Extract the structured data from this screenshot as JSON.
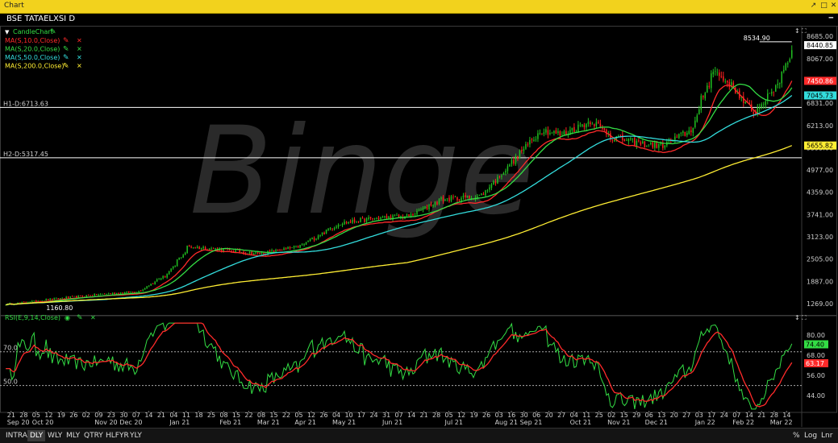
{
  "window": {
    "title": "Chart"
  },
  "symbol": {
    "label": "BSE TATAELXSI D"
  },
  "legend": {
    "chart_label": "CandleChart",
    "ma": [
      {
        "label": "MA(S,10.0,Close)",
        "color": "#ff2a2a",
        "icon": "pencil-icon"
      },
      {
        "label": "MA(S,20.0,Close)",
        "color": "#33dd44",
        "icon": "pencil-icon"
      },
      {
        "label": "MA(S,50.0,Close)",
        "color": "#33dddd",
        "icon": "pencil-icon"
      },
      {
        "label": "MA(S,200.0,Close)",
        "color": "#ffee33",
        "icon": "pencil-icon"
      }
    ],
    "rsi_label": "RSI(E,9,14,Close)"
  },
  "hlines": [
    {
      "label": "H1-D:6713.63",
      "value": 6713.63
    },
    {
      "label": "H2-D:5317.45",
      "value": 5317.45
    }
  ],
  "annotations": {
    "high": "8534.90",
    "low": "1160.80"
  },
  "watermark": "Binge",
  "price_badges": [
    {
      "label": "8440.85",
      "value": 8440.85,
      "bg": "#ffffff",
      "fg": "#000000"
    },
    {
      "label": "7450.86",
      "value": 7450.86,
      "bg": "#ff2a2a",
      "fg": "#ffffff"
    },
    {
      "label": "7045.73",
      "value": 7045.73,
      "bg": "#33dddd",
      "fg": "#000000"
    },
    {
      "label": "5655.82",
      "value": 5655.82,
      "bg": "#ffee33",
      "fg": "#000000"
    }
  ],
  "rsi_badges": [
    {
      "label": "74.40",
      "value": 74.4,
      "bg": "#33dd44",
      "fg": "#000000"
    },
    {
      "label": "63.17",
      "value": 63.17,
      "bg": "#ff2a2a",
      "fg": "#ffffff"
    }
  ],
  "rsi_levels": [
    {
      "label": "70.0",
      "value": 70
    },
    {
      "label": "50.0",
      "value": 50
    }
  ],
  "x_ticks": [
    {
      "top": "21",
      "bottom": "Sep 20"
    },
    {
      "top": "28",
      "bottom": ""
    },
    {
      "top": "05",
      "bottom": "Oct 20"
    },
    {
      "top": "12",
      "bottom": ""
    },
    {
      "top": "19",
      "bottom": ""
    },
    {
      "top": "26",
      "bottom": ""
    },
    {
      "top": "02",
      "bottom": ""
    },
    {
      "top": "09",
      "bottom": "Nov 20"
    },
    {
      "top": "23",
      "bottom": ""
    },
    {
      "top": "30",
      "bottom": "Dec 20"
    },
    {
      "top": "07",
      "bottom": ""
    },
    {
      "top": "14",
      "bottom": ""
    },
    {
      "top": "21",
      "bottom": ""
    },
    {
      "top": "04",
      "bottom": "Jan 21"
    },
    {
      "top": "11",
      "bottom": ""
    },
    {
      "top": "18",
      "bottom": ""
    },
    {
      "top": "25",
      "bottom": ""
    },
    {
      "top": "08",
      "bottom": "Feb 21"
    },
    {
      "top": "15",
      "bottom": ""
    },
    {
      "top": "22",
      "bottom": ""
    },
    {
      "top": "08",
      "bottom": "Mar 21"
    },
    {
      "top": "15",
      "bottom": ""
    },
    {
      "top": "22",
      "bottom": ""
    },
    {
      "top": "05",
      "bottom": "Apr 21"
    },
    {
      "top": "12",
      "bottom": ""
    },
    {
      "top": "26",
      "bottom": ""
    },
    {
      "top": "04",
      "bottom": "May 21"
    },
    {
      "top": "10",
      "bottom": ""
    },
    {
      "top": "17",
      "bottom": ""
    },
    {
      "top": "24",
      "bottom": ""
    },
    {
      "top": "31",
      "bottom": "Jun 21"
    },
    {
      "top": "07",
      "bottom": ""
    },
    {
      "top": "14",
      "bottom": ""
    },
    {
      "top": "21",
      "bottom": ""
    },
    {
      "top": "28",
      "bottom": ""
    },
    {
      "top": "05",
      "bottom": "Jul 21"
    },
    {
      "top": "12",
      "bottom": ""
    },
    {
      "top": "19",
      "bottom": ""
    },
    {
      "top": "26",
      "bottom": ""
    },
    {
      "top": "03",
      "bottom": "Aug 21"
    },
    {
      "top": "16",
      "bottom": ""
    },
    {
      "top": "30",
      "bottom": "Sep 21"
    },
    {
      "top": "06",
      "bottom": ""
    },
    {
      "top": "20",
      "bottom": ""
    },
    {
      "top": "27",
      "bottom": ""
    },
    {
      "top": "04",
      "bottom": "Oct 21"
    },
    {
      "top": "11",
      "bottom": ""
    },
    {
      "top": "25",
      "bottom": ""
    },
    {
      "top": "02",
      "bottom": "Nov 21"
    },
    {
      "top": "15",
      "bottom": ""
    },
    {
      "top": "29",
      "bottom": ""
    },
    {
      "top": "06",
      "bottom": "Dec 21"
    },
    {
      "top": "13",
      "bottom": ""
    },
    {
      "top": "20",
      "bottom": ""
    },
    {
      "top": "27",
      "bottom": ""
    },
    {
      "top": "03",
      "bottom": "Jan 22"
    },
    {
      "top": "17",
      "bottom": ""
    },
    {
      "top": "24",
      "bottom": ""
    },
    {
      "top": "07",
      "bottom": "Feb 22"
    },
    {
      "top": "14",
      "bottom": ""
    },
    {
      "top": "21",
      "bottom": ""
    },
    {
      "top": "28",
      "bottom": "Mar 22"
    },
    {
      "top": "14",
      "bottom": ""
    }
  ],
  "periods": [
    "INTRA",
    "DLY",
    "WLY",
    "MLY",
    "QTRY",
    "HLFYR",
    "YLY"
  ],
  "active_period": "DLY",
  "scale_buttons": [
    "%",
    "Log",
    "Lnr"
  ],
  "chart_data": [
    {
      "type": "candlestick",
      "title": "BSE TATAELXSI D",
      "ylim": [
        1000,
        8800
      ],
      "y_ticks": [
        8685,
        8067,
        7449,
        6831,
        6213,
        5595,
        4977,
        4359,
        3741,
        3123,
        2505,
        1887,
        1269
      ],
      "y_tick_labels": [
        "8685.00",
        "8067.00",
        "7449.00",
        "6831.00",
        "6213.00",
        "5595.00",
        "4977.00",
        "4359.00",
        "3741.00",
        "3123.00",
        "2505.00",
        "1887.00",
        "1269.00"
      ],
      "x_range": [
        "Sep 20",
        "Mar 22"
      ],
      "series": [
        {
          "name": "MA(S,10.0,Close)",
          "last": 7450.86
        },
        {
          "name": "MA(S,20.0,Close)"
        },
        {
          "name": "MA(S,50.0,Close)",
          "last": 7045.73
        },
        {
          "name": "MA(S,200.0,Close)",
          "last": 5655.82
        }
      ],
      "anchors": {
        "dates": [
          "2020-09-21",
          "2020-10-19",
          "2020-11-23",
          "2020-12-21",
          "2021-01-11",
          "2021-01-25",
          "2021-02-15",
          "2021-03-15",
          "2021-04-12",
          "2021-05-10",
          "2021-06-07",
          "2021-06-28",
          "2021-07-19",
          "2021-08-16",
          "2021-09-06",
          "2021-09-27",
          "2021-10-11",
          "2021-11-01",
          "2021-11-15",
          "2021-12-06",
          "2021-12-20",
          "2022-01-10",
          "2022-01-24",
          "2022-02-07",
          "2022-02-21",
          "2022-03-07",
          "2022-03-14",
          "2022-03-21"
        ],
        "close": [
          1250,
          1380,
          1520,
          1600,
          2100,
          2850,
          2780,
          2650,
          2850,
          3500,
          3650,
          3700,
          4150,
          4250,
          5150,
          6100,
          5950,
          6350,
          5900,
          5700,
          5650,
          6100,
          7750,
          7300,
          6550,
          7150,
          7700,
          8440
        ]
      },
      "hlines": [
        6713.63,
        5317.45
      ],
      "high": 8534.9,
      "low": 1160.8,
      "last": 8440.85
    },
    {
      "type": "line",
      "title": "RSI(E,9,14,Close)",
      "ylim": [
        35,
        88
      ],
      "y_ticks": [
        80,
        68,
        56,
        44
      ],
      "y_tick_labels": [
        "80.00",
        "68.00",
        "56.00",
        "44.00"
      ],
      "levels": [
        70,
        50
      ],
      "series": [
        {
          "name": "RSI",
          "last": 74.4
        },
        {
          "name": "Signal",
          "last": 63.17
        }
      ]
    }
  ]
}
